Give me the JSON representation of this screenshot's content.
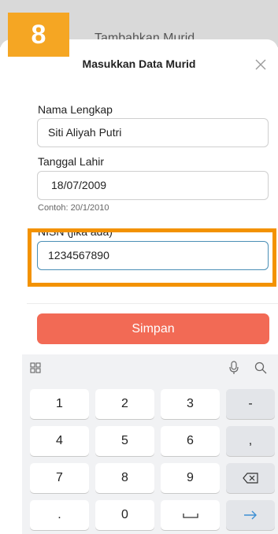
{
  "step_badge": "8",
  "background_title": "Tambahkan Murid",
  "sheet": {
    "title": "Masukkan Data Murid"
  },
  "fields": [
    {
      "label": "Nama Lengkap",
      "value": "Siti Aliyah Putri"
    },
    {
      "label": "Tanggal Lahir",
      "value": "18/07/2009",
      "hint": "Contoh: 20/1/2010"
    },
    {
      "label": "NISN (jika ada)",
      "value": "1234567890"
    }
  ],
  "save_button": "Simpan",
  "keyboard": {
    "keys": [
      [
        "1",
        "2",
        "3",
        "-"
      ],
      [
        "4",
        "5",
        "6",
        ","
      ],
      [
        "7",
        "8",
        "9",
        "backspace-icon"
      ],
      [
        ".",
        "0",
        "space-icon",
        "enter-arrow-icon"
      ]
    ]
  },
  "colors": {
    "accent": "#f26a55",
    "highlight": "#f39200",
    "badge": "#f5a623",
    "focus": "#4a8fb6"
  }
}
